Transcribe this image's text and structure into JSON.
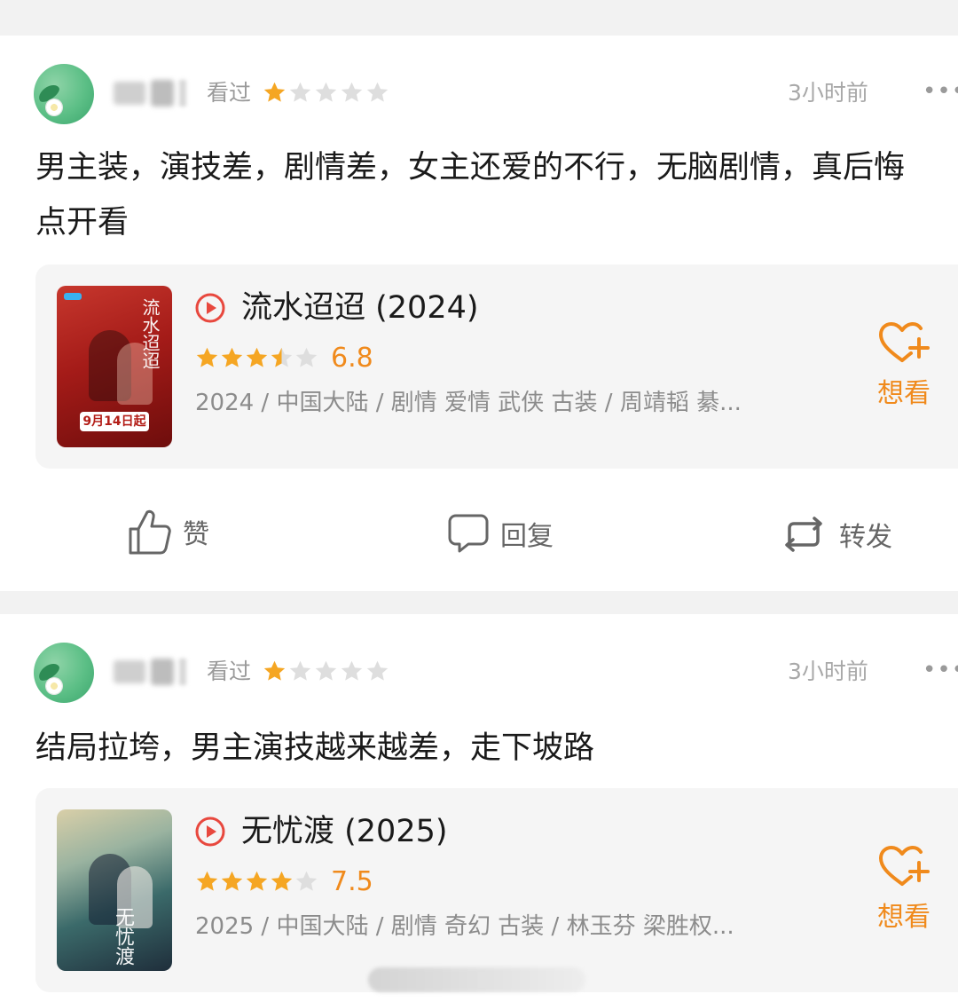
{
  "reviews": [
    {
      "status": "看过",
      "rating": 1,
      "time": "3小时前",
      "more": "•••",
      "text": "男主装，演技差，剧情差，女主还爱的不行，无脑剧情，真后悔点开看",
      "movie": {
        "title": "流水迢迢 (2024)",
        "rating_stars": 3.5,
        "score": "6.8",
        "meta": "2024 / 中国大陆 / 剧情 爱情 武侠 古装 / 周靖韬 綦...",
        "poster_title": "流水迢迢",
        "poster_date": "9月14日起",
        "want_label": "想看"
      }
    },
    {
      "status": "看过",
      "rating": 1,
      "time": "3小时前",
      "more": "•••",
      "text": "结局拉垮，男主演技越来越差，走下坡路",
      "movie": {
        "title": "无忧渡 (2025)",
        "rating_stars": 4,
        "score": "7.5",
        "meta": "2025 / 中国大陆 / 剧情 奇幻 古装 / 林玉芬 梁胜权...",
        "poster_title": "无忧渡",
        "want_label": "想看"
      }
    }
  ],
  "actions": {
    "like_label": "赞",
    "reply_label": "回复",
    "repost_label": "转发"
  },
  "colors": {
    "star_filled": "#f5a623",
    "star_empty": "#dedede",
    "accent": "#f08a1c",
    "play_red": "#e8483e"
  }
}
